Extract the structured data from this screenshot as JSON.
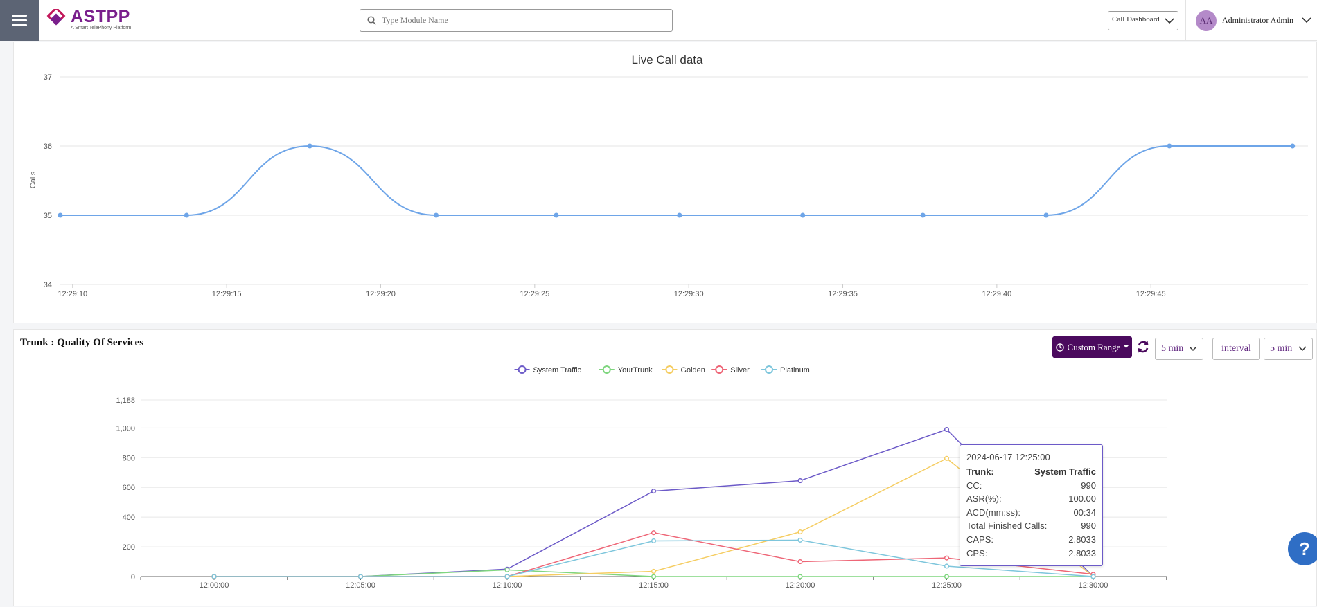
{
  "header": {
    "logo_name": "ASTPP",
    "logo_tagline": "A Smart TelePhony Platform",
    "search_placeholder": "Type Module Name",
    "dashboard_select": "Call Dashboard",
    "user_initials": "AA",
    "user_name": "Administrator Admin"
  },
  "live_panel": {
    "title": "Live Call data"
  },
  "trunk_panel": {
    "title": "Trunk : Quality Of Services",
    "range_button": "Custom Range",
    "range_select": "5 min",
    "interval_label": "interval",
    "interval_select": "5 min"
  },
  "tooltip": {
    "time": "2024-06-17 12:25:00",
    "rows": [
      {
        "label": "Trunk:",
        "value": "System Traffic",
        "bold": true
      },
      {
        "label": "CC:",
        "value": "990"
      },
      {
        "label": "ASR(%):",
        "value": "100.00"
      },
      {
        "label": "ACD(mm:ss):",
        "value": "00:34"
      },
      {
        "label": "Total Finished Calls:",
        "value": "990"
      },
      {
        "label": "CAPS:",
        "value": "2.8033"
      },
      {
        "label": "CPS:",
        "value": "2.8033"
      }
    ]
  },
  "help_label": "?",
  "colors": {
    "brand": "#7a1f8c",
    "button": "#4b0a5e",
    "live_line": "#6ea5e8",
    "help": "#2f6ec5"
  },
  "chart_data": [
    {
      "type": "line",
      "title": "Live Call data",
      "ylabel": "Calls",
      "xlabel": "",
      "ylim": [
        34,
        37
      ],
      "y_ticks": [
        "34",
        "35",
        "36",
        "37"
      ],
      "x_ticks": [
        "12:29:10",
        "12:29:15",
        "12:29:20",
        "12:29:25",
        "12:29:30",
        "12:29:35",
        "12:29:40",
        "12:29:45"
      ],
      "x_tick_seconds": [
        10,
        15,
        20,
        25,
        30,
        35,
        40,
        45
      ],
      "x_range_seconds": [
        9.6,
        50.1
      ],
      "x_seconds": [
        9.6,
        13.7,
        17.7,
        21.8,
        25.7,
        29.7,
        33.7,
        37.6,
        41.6,
        45.6,
        49.6
      ],
      "values": [
        35,
        35,
        36,
        35,
        35,
        35,
        35,
        35,
        35,
        36,
        36
      ],
      "grid": true,
      "smooth": true
    },
    {
      "type": "line",
      "title": "",
      "xlabel": "",
      "ylabel": "",
      "ylim": [
        0,
        1188
      ],
      "y_ticks": [
        0,
        200,
        400,
        600,
        800,
        1000,
        1188
      ],
      "y_tick_labels": [
        "0",
        "200",
        "400",
        "600",
        "800",
        "1,000",
        "1,188"
      ],
      "categories": [
        "12:00:00",
        "12:05:00",
        "12:10:00",
        "12:15:00",
        "12:20:00",
        "12:25:00",
        "12:30:00"
      ],
      "legend_position": "top-center",
      "series": [
        {
          "name": "System Traffic",
          "color": "#6c5ac8",
          "values": [
            0,
            0,
            50,
            575,
            645,
            990,
            0
          ]
        },
        {
          "name": "YourTrunk",
          "color": "#7fd67f",
          "values": [
            0,
            0,
            45,
            0,
            0,
            0,
            0
          ]
        },
        {
          "name": "Golden",
          "color": "#f5cd62",
          "values": [
            0,
            0,
            0,
            35,
            300,
            795,
            0
          ]
        },
        {
          "name": "Silver",
          "color": "#ee6677",
          "values": [
            0,
            0,
            0,
            295,
            100,
            125,
            15
          ]
        },
        {
          "name": "Platinum",
          "color": "#7ec6dc",
          "values": [
            0,
            0,
            0,
            240,
            245,
            70,
            0
          ]
        }
      ],
      "grid": true
    }
  ]
}
